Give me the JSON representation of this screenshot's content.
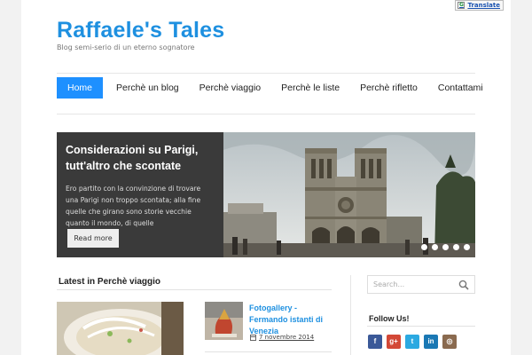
{
  "translate": {
    "label": "Translate"
  },
  "header": {
    "title": "Raffaele's Tales",
    "tagline": "Blog semi-serio di un eterno sognatore"
  },
  "nav": {
    "items": [
      {
        "label": "Home"
      },
      {
        "label": "Perchè un blog"
      },
      {
        "label": "Perchè viaggio"
      },
      {
        "label": "Perchè le liste"
      },
      {
        "label": "Perchè rifletto"
      },
      {
        "label": "Contattami"
      }
    ]
  },
  "slider": {
    "title": "Considerazioni su Parigi, tutt'altro che scontate",
    "excerpt": "Ero partito con la convinzione di trovare una Parigi non troppo scontata; alla fine quelle che girano sono storie vecchie quanto il mondo, di quelle",
    "button": "Read more",
    "slides_count": 5
  },
  "latest": {
    "heading": "Latest in Perchè viaggio",
    "post_title": "Fotogallery - Fermando istanti di Venezia",
    "post_date": "7 novembre 2014"
  },
  "sidebar": {
    "search_placeholder": "Search...",
    "follow_heading": "Follow Us!",
    "socials": [
      {
        "icon": "facebook-icon",
        "glyph": "f",
        "color": "#3b5998"
      },
      {
        "icon": "google-plus-icon",
        "glyph": "g+",
        "color": "#d34836"
      },
      {
        "icon": "twitter-icon",
        "glyph": "t",
        "color": "#2ba9e1"
      },
      {
        "icon": "linkedin-icon",
        "glyph": "in",
        "color": "#1a78b4"
      },
      {
        "icon": "instagram-icon",
        "glyph": "◎",
        "color": "#8a6a4f"
      }
    ]
  },
  "colors": {
    "accent": "#1e90ff",
    "title": "#1e90e0",
    "slide_box": "#3a3a3a"
  }
}
